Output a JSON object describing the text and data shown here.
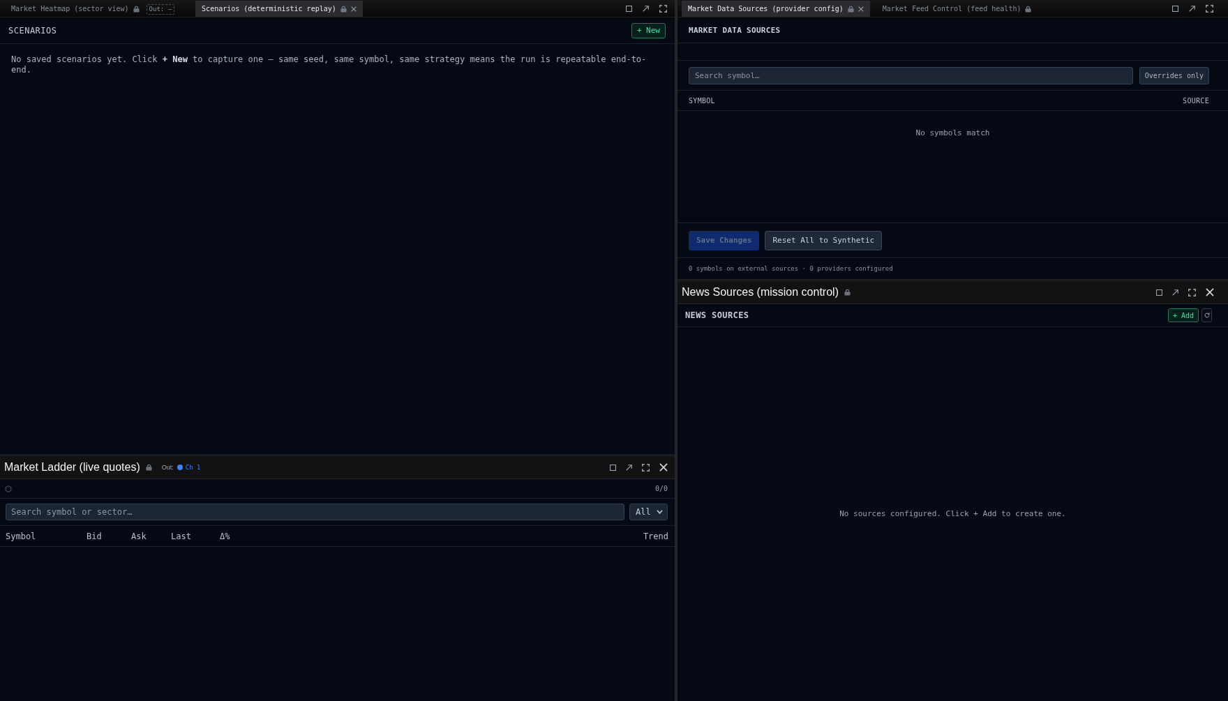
{
  "left_top_pane": {
    "tabs": [
      {
        "label": "Market Heatmap (sector view)",
        "selected": false,
        "locked": true,
        "output": "Out: –"
      },
      {
        "label": "Scenarios (deterministic replay)",
        "selected": true,
        "locked": true
      }
    ],
    "scenarios": {
      "title": "SCENARIOS",
      "new_button": "+ New",
      "empty_message": "No saved scenarios yet. Click **+ New** to capture one — same seed, same symbol, same strategy means the run is repeatable end-to-end."
    }
  },
  "market_ladder": {
    "title": "Market Ladder (live quotes)",
    "locked": true,
    "output": {
      "label": "Out:",
      "channel": "Ch 1"
    },
    "count": "0/0",
    "search": {
      "placeholder": "Search symbol or sector…"
    },
    "filter": {
      "value": "All"
    },
    "columns": [
      "Symbol",
      "Bid",
      "Ask",
      "Last",
      "Δ%",
      "Trend"
    ]
  },
  "right_top_pane": {
    "tabs": [
      {
        "label": "Market Data Sources (provider config)",
        "selected": true,
        "locked": true
      },
      {
        "label": "Market Feed Control (feed health)",
        "selected": false,
        "locked": true
      }
    ],
    "market_data_sources": {
      "title": "MARKET DATA SOURCES",
      "search": {
        "placeholder": "Search symbol…"
      },
      "overrides_toggle": {
        "label": "Overrides only",
        "on": false
      },
      "columns": [
        "SYMBOL",
        "SOURCE"
      ],
      "empty_message": "No symbols match",
      "buttons": [
        {
          "label": "Save Changes",
          "kind": "primary",
          "disabled": true
        },
        {
          "label": "Reset All to Synthetic",
          "kind": "secondary",
          "disabled": false
        }
      ],
      "footer": "0 symbols on external sources · 0 providers configured"
    }
  },
  "news_sources": {
    "title": "News Sources (mission control)",
    "locked": true,
    "section_title": "NEWS SOURCES",
    "add_button": "+ Add",
    "empty_message": "No sources configured. Click + Add to create one."
  }
}
